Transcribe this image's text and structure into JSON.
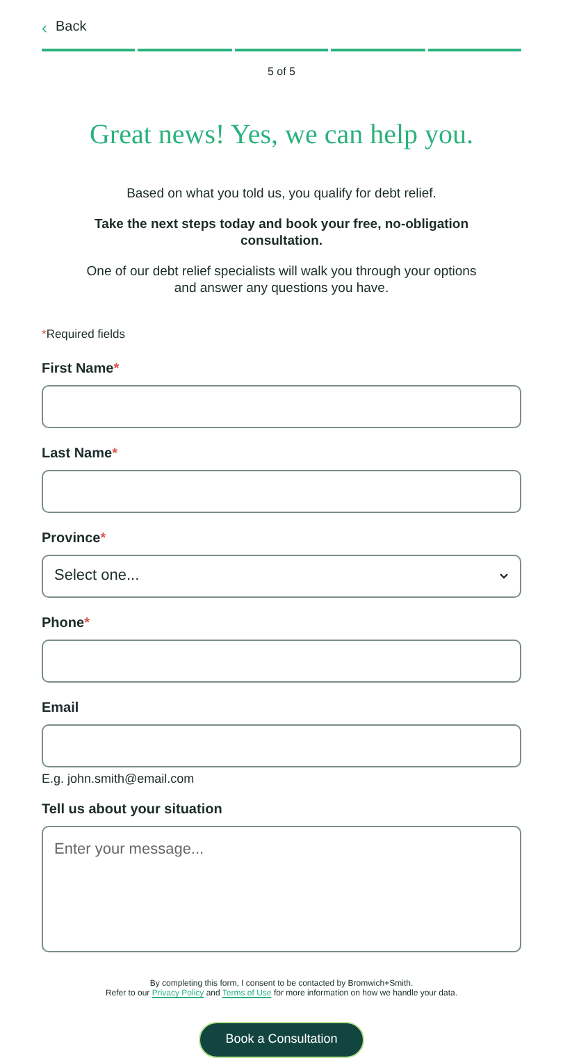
{
  "back_link": {
    "icon": "‹",
    "label": "Back"
  },
  "progress": {
    "steps": [
      {
        "complete": true
      },
      {
        "complete": true
      },
      {
        "complete": true
      },
      {
        "complete": true
      },
      {
        "complete": true
      }
    ],
    "label": "5 of 5"
  },
  "heading": "Great news! Yes, we can help you.",
  "intro": [
    "Based on what you told us, you qualify for debt relief.",
    "**Take the next steps today and book your free, no-obligation consultation.**",
    "One of our debt relief specialists will walk you through your options and answer any questions you have."
  ],
  "required_note": {
    "mark": "*",
    "text": "Required fields"
  },
  "fields": [
    {
      "kind": "text",
      "label": "First Name",
      "required_mark": "*"
    },
    {
      "kind": "text",
      "label": "Last Name",
      "required_mark": "*"
    },
    {
      "kind": "select",
      "label": "Province",
      "required_mark": "*",
      "value": "Select one..."
    },
    {
      "kind": "text",
      "label": "Phone",
      "required_mark": "*"
    },
    {
      "kind": "text",
      "label": "Email",
      "hint": "E.g. john.smith@email.com"
    },
    {
      "kind": "textarea",
      "label": "Tell us about your situation",
      "placeholder": "Enter your message..."
    }
  ],
  "consent": {
    "line_1": "By completing this form, I consent to be contacted by Bromwich+Smith.",
    "line_2": [
      {
        "text": "Refer to our",
        "link": false
      },
      {
        "text": "Privacy Policy",
        "link": true
      },
      {
        "text": "and",
        "link": false
      },
      {
        "text": "Terms of Use",
        "link": true
      },
      {
        "text": "for more information on how we handle your data.",
        "link": false
      }
    ]
  },
  "submit": "Book a Consultation"
}
